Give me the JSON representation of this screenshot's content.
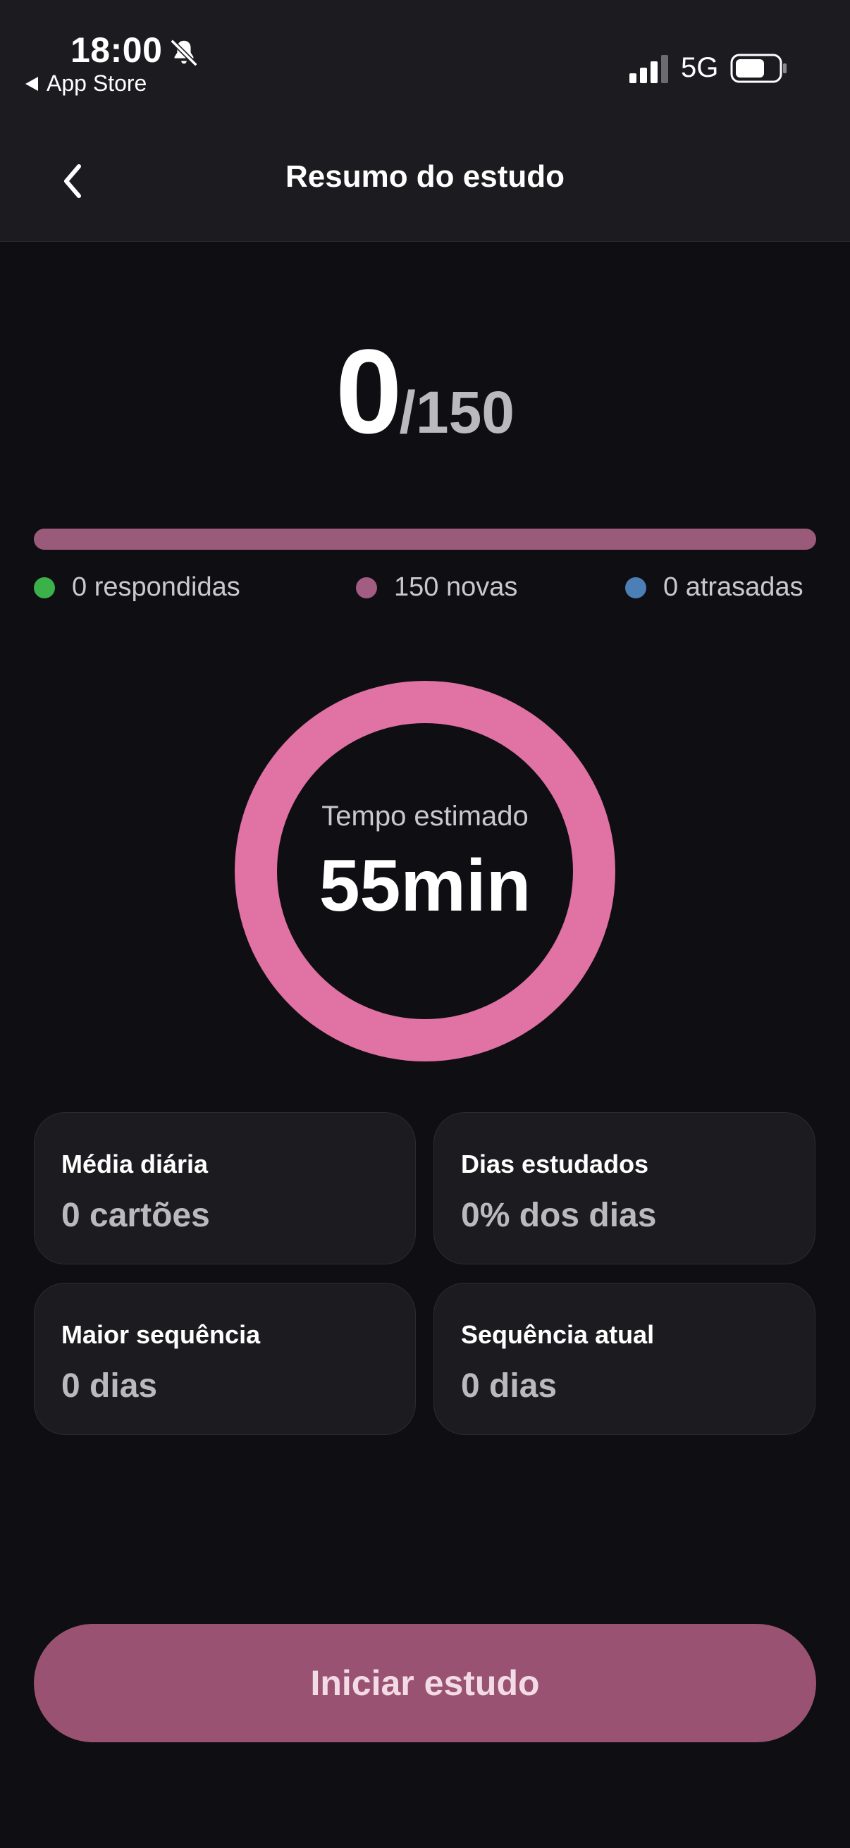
{
  "status_bar": {
    "time": "18:00",
    "back_app": "App Store",
    "network": "5G"
  },
  "nav": {
    "title": "Resumo do estudo"
  },
  "counter": {
    "done": "0",
    "total": "/150"
  },
  "progress": {
    "answered_fraction": 0
  },
  "legend": [
    {
      "label": "0 respondidas",
      "color": "#3bb14a"
    },
    {
      "label": "150 novas",
      "color": "#a35c82"
    },
    {
      "label": "0 atrasadas",
      "color": "#4b7fb5"
    }
  ],
  "estimate": {
    "label": "Tempo estimado",
    "value": "55min"
  },
  "stats": [
    {
      "label": "Média diária",
      "value": "0 cartões"
    },
    {
      "label": "Dias estudados",
      "value": "0% dos dias"
    },
    {
      "label": "Maior sequência",
      "value": "0 dias"
    },
    {
      "label": "Sequência atual",
      "value": "0 dias"
    }
  ],
  "start_button": {
    "label": "Iniciar estudo"
  },
  "colors": {
    "background": "#0f0e12",
    "surface": "#1c1c20",
    "ring": "#e072a4",
    "button": "#9a5272"
  }
}
